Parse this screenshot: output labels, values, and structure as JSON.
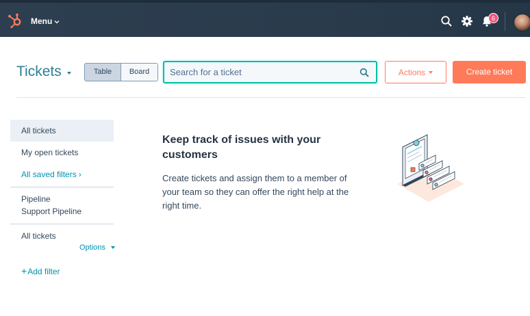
{
  "nav": {
    "menu_label": "Menu",
    "notification_count": "6",
    "icons": [
      "hubspot-logo-icon",
      "search-icon",
      "gear-icon",
      "bell-icon"
    ]
  },
  "header": {
    "title": "Tickets",
    "view_toggle": {
      "table_label": "Table",
      "board_label": "Board",
      "selected": "Table"
    },
    "search": {
      "placeholder": "Search for a ticket",
      "value": ""
    },
    "actions_label": "Actions",
    "create_label": "Create ticket"
  },
  "sidebar": {
    "views": [
      {
        "label": "All tickets",
        "active": true
      },
      {
        "label": "My open tickets",
        "active": false
      }
    ],
    "saved_filters_label": "All saved filters",
    "pipeline_heading": "Pipeline",
    "pipeline_value": "Support Pipeline",
    "current_view_heading": "All tickets",
    "options_label": "Options",
    "add_filter_label": "Add filter"
  },
  "empty_state": {
    "title": "Keep track of issues with your customers",
    "body": "Create tickets and assign them to a member of your team so they can offer the right help at the right time."
  },
  "colors": {
    "nav_bg": "#2d3e50",
    "accent_orange": "#ff7a59",
    "link_teal": "#0091ae",
    "title_teal": "#2d7f95",
    "badge_pink": "#f2547d",
    "search_focus": "#00bda5"
  }
}
